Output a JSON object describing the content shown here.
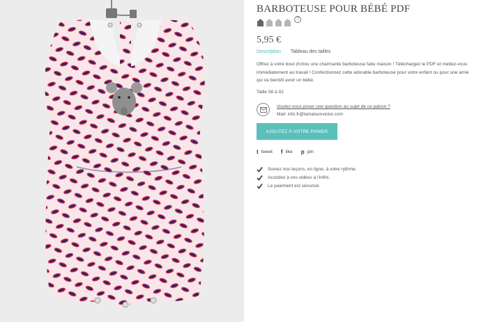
{
  "product": {
    "title": "BARBOTEUSE POUR BÉBÉ PDF",
    "difficulty_level": 1,
    "difficulty_max": 4,
    "help_symbol": "?",
    "price": "5,95 €",
    "image_icon": "romper-photo"
  },
  "tabs": [
    {
      "label": "Description",
      "active": true
    },
    {
      "label": "Tableau des tailles",
      "active": false
    }
  ],
  "description": "Offrez à votre bout d'chou une charmante barboteuse faite maison ! Téléchargez le PDF et mettez-vous immédiatement au travail ! Confectionnez cette adorable barboteuse pour votre enfant ou pour une amie qui va bientôt avoir un bébé.",
  "size_note": "Taille 56 à 92",
  "contact": {
    "question_link": "Voulez-vous poser une question au sujet de ce patron ?",
    "mail": "Mail: info.fr@lamaisonvictor.com",
    "icon": "envelope-icon"
  },
  "cart": {
    "label": "AJOUTEZ À VOTRE PANIER"
  },
  "share": [
    {
      "glyph": "t",
      "label": "tweet",
      "icon": "twitter-icon"
    },
    {
      "glyph": "f",
      "label": "like",
      "icon": "facebook-icon"
    },
    {
      "glyph": "p",
      "label": "pin",
      "icon": "pinterest-icon"
    }
  ],
  "features": [
    "Suivez nos leçons, en ligne, à votre rythme.",
    "Accédez à vos vidéos à l'infini.",
    "Le paiement est sécurisé."
  ],
  "colors": {
    "accent": "#5bbfba",
    "tab_active": "#4bb9b3",
    "fabric_base": "#f7e6ea",
    "fabric_leaf": "#2e2860",
    "fabric_outline": "#e8294f"
  }
}
